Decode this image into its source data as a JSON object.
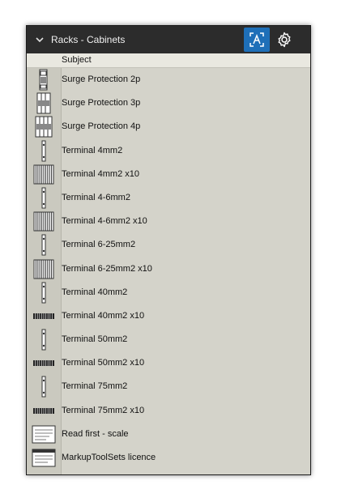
{
  "panel": {
    "title": "Racks - Cabinets",
    "column_header": "Subject",
    "items": [
      {
        "label": "Surge Protection 2p",
        "icon": "surge-protection-2p-icon"
      },
      {
        "label": "Surge Protection 3p",
        "icon": "surge-protection-3p-icon"
      },
      {
        "label": "Surge Protection 4p",
        "icon": "surge-protection-4p-icon"
      },
      {
        "label": "Terminal 4mm2",
        "icon": "terminal-single-icon"
      },
      {
        "label": "Terminal 4mm2 x10",
        "icon": "terminal-block-icon"
      },
      {
        "label": "Terminal 4-6mm2",
        "icon": "terminal-single-icon"
      },
      {
        "label": "Terminal 4-6mm2 x10",
        "icon": "terminal-block-icon"
      },
      {
        "label": "Terminal 6-25mm2",
        "icon": "terminal-single-icon"
      },
      {
        "label": "Terminal 6-25mm2 x10",
        "icon": "terminal-block-icon"
      },
      {
        "label": "Terminal 40mm2",
        "icon": "terminal-single-icon"
      },
      {
        "label": "Terminal 40mm2 x10",
        "icon": "terminal-strip-icon"
      },
      {
        "label": "Terminal 50mm2",
        "icon": "terminal-single-icon"
      },
      {
        "label": "Terminal 50mm2 x10",
        "icon": "terminal-strip-icon"
      },
      {
        "label": "Terminal 75mm2",
        "icon": "terminal-single-icon"
      },
      {
        "label": "Terminal 75mm2 x10",
        "icon": "terminal-strip-icon"
      },
      {
        "label": "Read first - scale",
        "icon": "document-icon"
      },
      {
        "label": "MarkupToolSets licence",
        "icon": "licence-document-icon"
      }
    ]
  },
  "colors": {
    "header_bg": "#2c2c2c",
    "accent": "#1e6fb8",
    "panel_bg": "#d4d3ca"
  }
}
